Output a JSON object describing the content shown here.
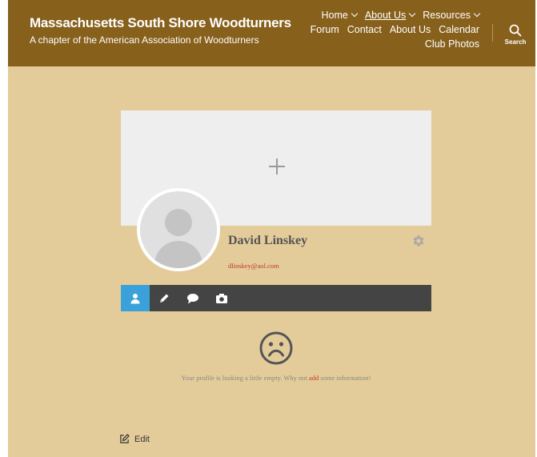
{
  "header": {
    "site_title": "Massachusetts South Shore Woodturners",
    "site_description": "A chapter of the American Association of Woodturners",
    "background_color": "#87601c",
    "nav": {
      "row1": [
        {
          "label": "Home",
          "has_dropdown": true
        },
        {
          "label": "About Us",
          "has_dropdown": true,
          "current": true
        },
        {
          "label": "Resources",
          "has_dropdown": true
        }
      ],
      "row2": [
        {
          "label": "Forum"
        },
        {
          "label": "Contact"
        },
        {
          "label": "About Us"
        },
        {
          "label": "Calendar"
        }
      ],
      "row3": [
        {
          "label": "Club Photos"
        }
      ]
    },
    "search": {
      "icon": "search-icon",
      "label": "Search"
    }
  },
  "profile": {
    "cover": {
      "icon": "plus-icon"
    },
    "avatar": {
      "icon": "default-avatar"
    },
    "display_name": "David Linskey",
    "email": "dlinskey@aol.com",
    "settings_icon": "gear-icon",
    "tabs": [
      {
        "icon": "user-icon",
        "active": true
      },
      {
        "icon": "pencil-icon",
        "active": false
      },
      {
        "icon": "comment-icon",
        "active": false
      },
      {
        "icon": "camera-icon",
        "active": false
      }
    ],
    "empty_state": {
      "icon": "sad-face-icon",
      "message_before": "Your profile is looking a little empty. Why not ",
      "link": "add",
      "message_after": " some information!"
    }
  },
  "edit_link": {
    "icon": "edit-icon",
    "label": "Edit"
  },
  "colors": {
    "page_background": "#e4cc9a",
    "accent_tab": "#3ba1da",
    "tab_bar": "#444444",
    "link_red": "#c0392b"
  }
}
